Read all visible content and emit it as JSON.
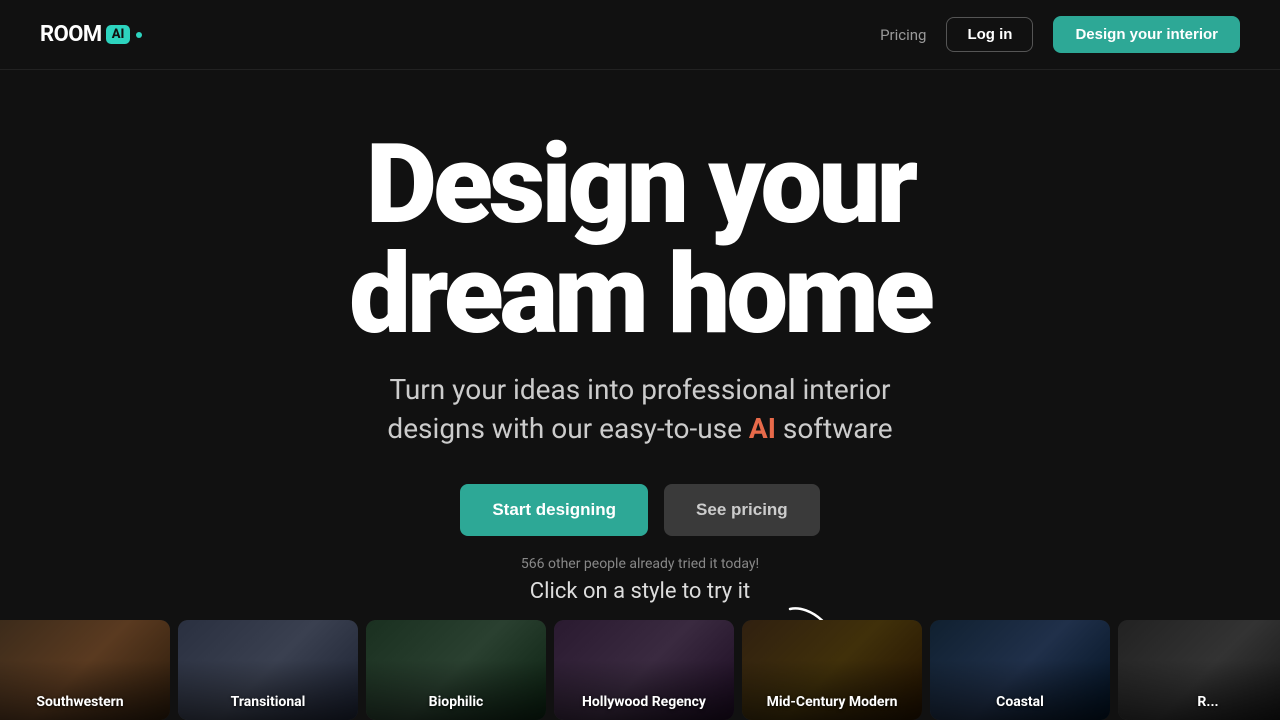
{
  "logo": {
    "text": "ROOM",
    "ai_badge": "AI",
    "dot": "·"
  },
  "nav": {
    "pricing_label": "Pricing",
    "login_label": "Log in",
    "cta_label": "Design your interior"
  },
  "hero": {
    "title_line1": "Design your",
    "title_line2": "dream home",
    "subtitle_part1": "Turn your ideas into professional interior",
    "subtitle_part2": "designs with our easy-to-use",
    "subtitle_ai": "AI",
    "subtitle_part3": "software",
    "btn_start": "Start designing",
    "btn_pricing": "See pricing",
    "social_proof": "566 other people already tried it today!"
  },
  "styles_section": {
    "click_label": "Click on a style to try it",
    "style_label": "style to try",
    "cards": [
      {
        "id": "southwestern",
        "label": "Southwestern",
        "bg_class": "card-southwestern"
      },
      {
        "id": "transitional",
        "label": "Transitional",
        "bg_class": "card-transitional"
      },
      {
        "id": "biophilic",
        "label": "Biophilic",
        "bg_class": "card-biophilic"
      },
      {
        "id": "hollywood",
        "label": "Hollywood Regency",
        "bg_class": "card-hollywood"
      },
      {
        "id": "midcentury",
        "label": "Mid-Century Modern",
        "bg_class": "card-midcentury"
      },
      {
        "id": "coastal",
        "label": "Coastal",
        "bg_class": "card-coastal"
      },
      {
        "id": "extra",
        "label": "R...",
        "bg_class": "card-extra"
      }
    ]
  },
  "colors": {
    "teal": "#2da896",
    "ai_orange": "#e86a4a",
    "bg": "#111111"
  }
}
